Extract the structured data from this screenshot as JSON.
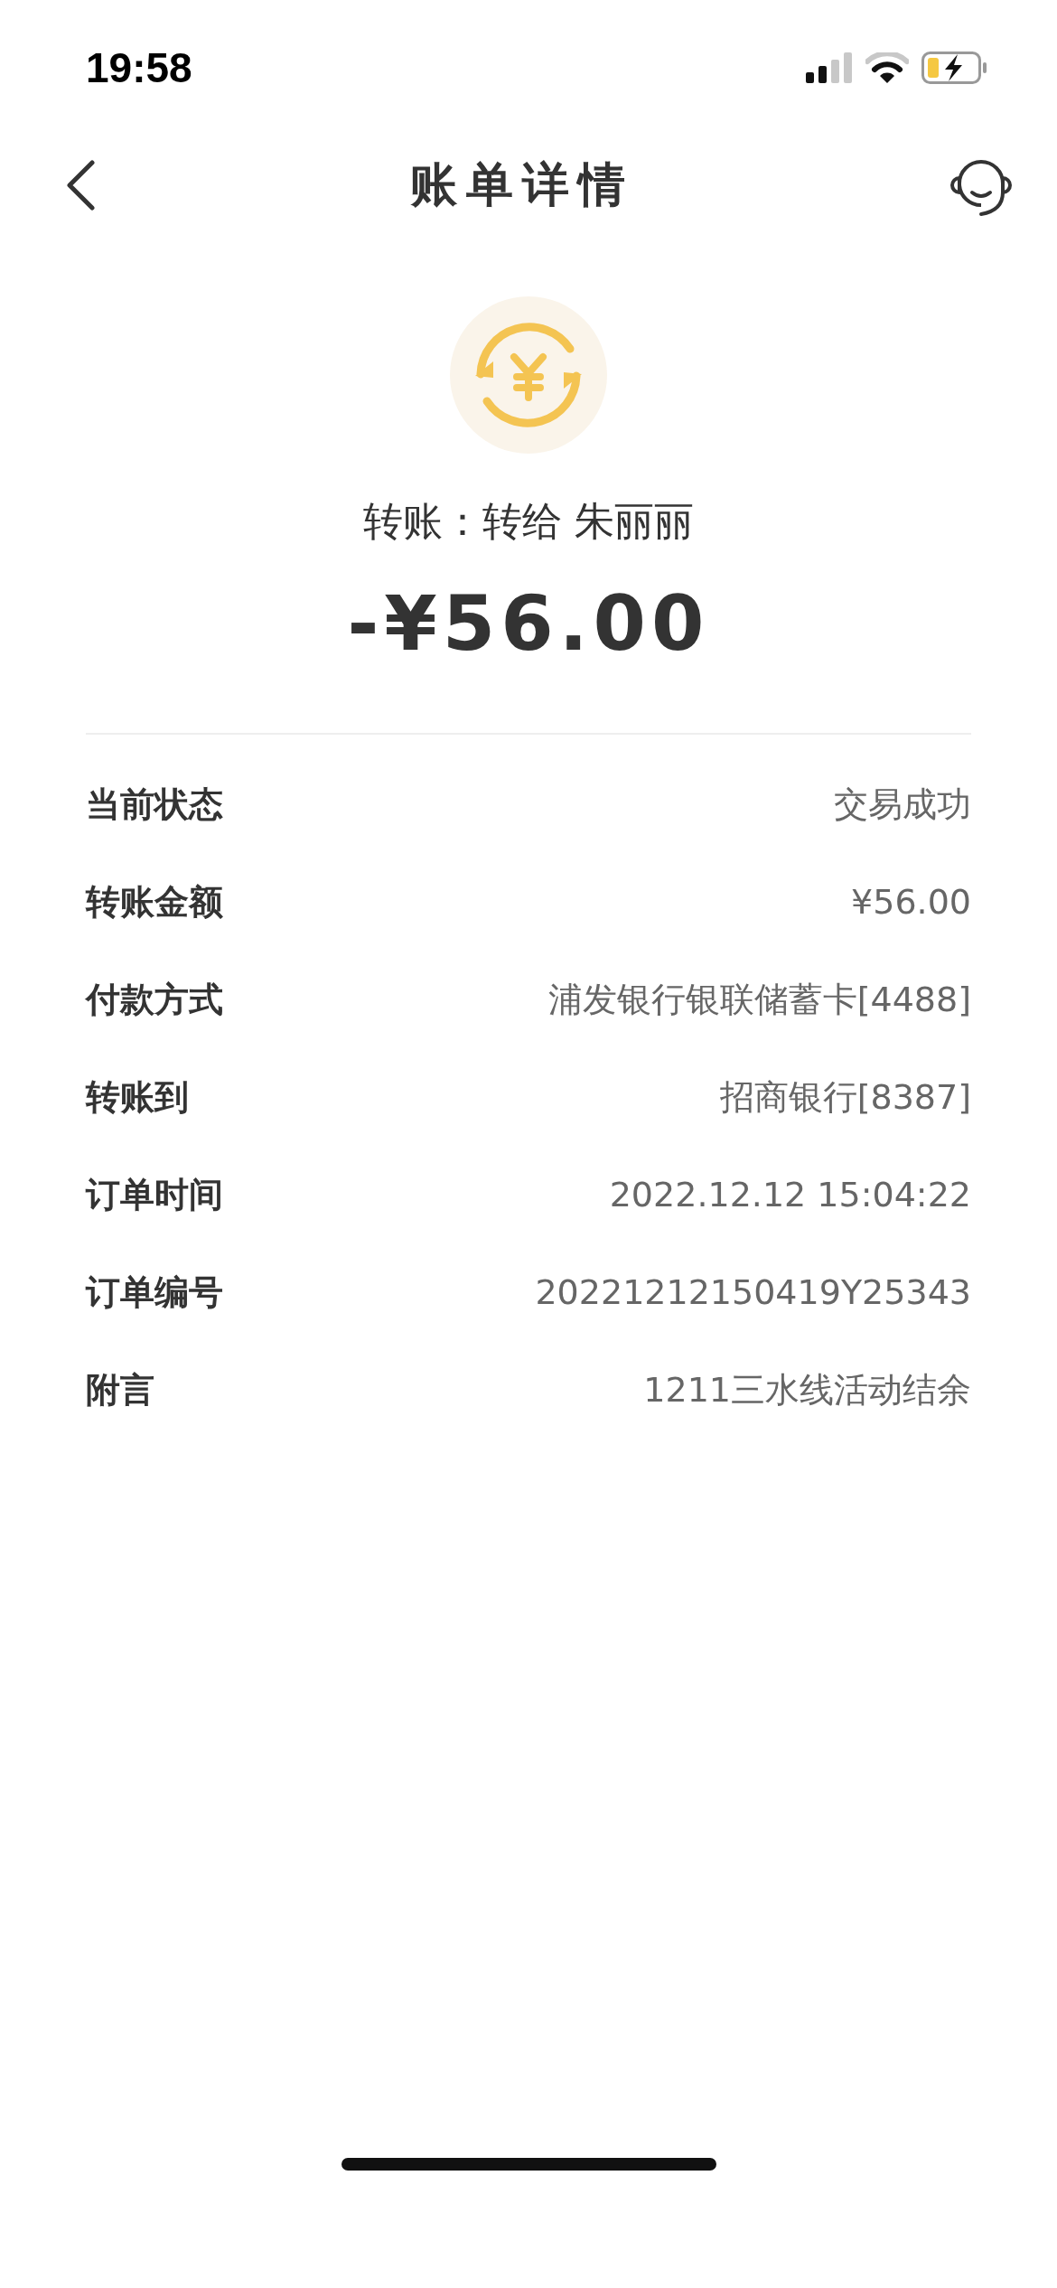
{
  "status_bar": {
    "time": "19:58"
  },
  "nav": {
    "title": "账单详情"
  },
  "summary": {
    "subtitle": "转账：转给 朱丽丽",
    "amount": "-¥56.00"
  },
  "details": [
    {
      "label": "当前状态",
      "value": "交易成功"
    },
    {
      "label": "转账金额",
      "value": "¥56.00"
    },
    {
      "label": "付款方式",
      "value": "浦发银行银联储蓄卡[4488]"
    },
    {
      "label": "转账到",
      "value": "招商银行[8387]"
    },
    {
      "label": "订单时间",
      "value": "2022.12.12 15:04:22"
    },
    {
      "label": "订单编号",
      "value": "20221212150419Y25343"
    },
    {
      "label": "附言",
      "value": "1211三水线活动结余"
    }
  ]
}
